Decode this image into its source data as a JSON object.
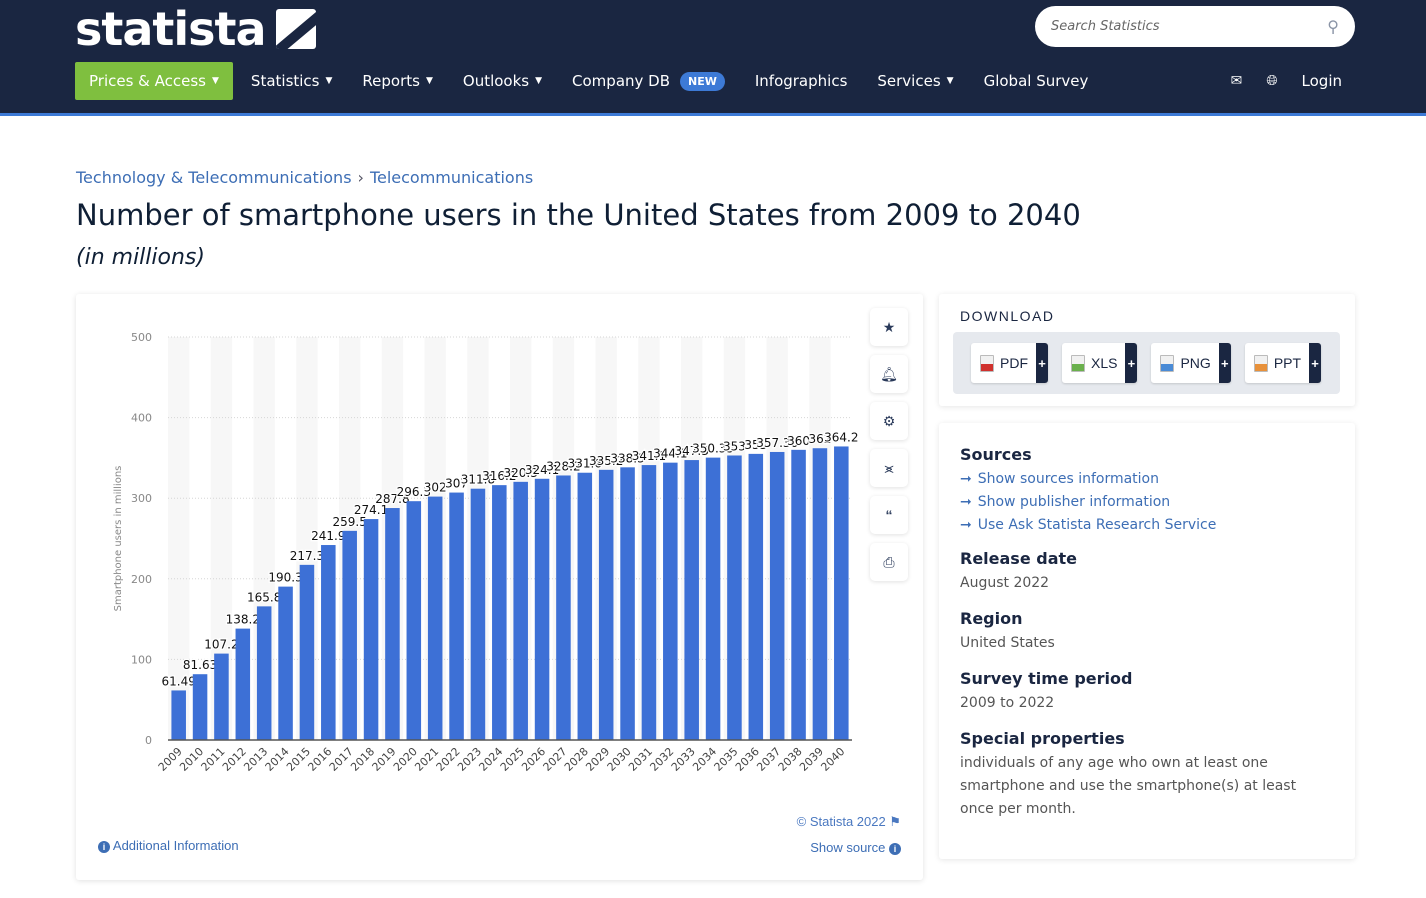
{
  "header": {
    "logo_text": "statista",
    "search_placeholder": "Search Statistics",
    "nav": [
      {
        "label": "Prices & Access",
        "dropdown": true,
        "active": true
      },
      {
        "label": "Statistics",
        "dropdown": true
      },
      {
        "label": "Reports",
        "dropdown": true
      },
      {
        "label": "Outlooks",
        "dropdown": true
      },
      {
        "label": "Company DB",
        "badge": "NEW"
      },
      {
        "label": "Infographics"
      },
      {
        "label": "Services",
        "dropdown": true
      },
      {
        "label": "Global Survey"
      }
    ],
    "login_label": "Login",
    "caret": "▼",
    "colors": {
      "navbar": "#1a2641",
      "active": "#7fbf3f",
      "accent": "#3d7ad6"
    }
  },
  "breadcrumb": [
    "Technology & Telecommunications",
    "Telecommunications"
  ],
  "breadcrumb_sep": "›",
  "page": {
    "title": "Number of smartphone users in the United States from 2009 to 2040",
    "subtitle": "(in millions)"
  },
  "chart_tools": [
    "star-icon",
    "bell-icon",
    "gear-icon",
    "share-icon",
    "quote-icon",
    "print-icon"
  ],
  "chart_footer": {
    "copyright": "© Statista 2022",
    "show_source": "Show source",
    "additional_info": "Additional Information"
  },
  "chart_data": {
    "type": "bar",
    "title": "Number of smartphone users in the United States from 2009 to 2040",
    "xlabel": "",
    "ylabel": "Smartphone users in millions",
    "ylim": [
      0,
      500
    ],
    "yticks": [
      0,
      100,
      200,
      300,
      400,
      500
    ],
    "grid": true,
    "bar_color": "#3d70d6",
    "categories": [
      "2009",
      "2010",
      "2011",
      "2012",
      "2013",
      "2014",
      "2015",
      "2016",
      "2017",
      "2018",
      "2019",
      "2020",
      "2021",
      "2022",
      "2023",
      "2024",
      "2025",
      "2026",
      "2027",
      "2028",
      "2029",
      "2030",
      "2031",
      "2032",
      "2033",
      "2034",
      "2035",
      "2036",
      "2037",
      "2038",
      "2039",
      "2040"
    ],
    "values": [
      61.49,
      81.63,
      107.2,
      138.2,
      165.8,
      190.3,
      217.3,
      241.9,
      259.5,
      274.1,
      287.8,
      296.3,
      302,
      307,
      311.8,
      316.2,
      320.3,
      324.1,
      328.2,
      331.6,
      335.2,
      338.3,
      341.1,
      344.1,
      347.3,
      350.35,
      353,
      355,
      357.36,
      360,
      362,
      364.2
    ],
    "labels": [
      "61.49",
      "81.63",
      "107.2",
      "138.2",
      "165.8",
      "190.3",
      "217.3",
      "241.9",
      "259.5",
      "274.1",
      "287.8",
      "296.3",
      "302",
      "307",
      "311.8",
      "316.2",
      "320.3",
      "324.1",
      "328.2",
      "331.6",
      "335.2",
      "338.3",
      "341.1",
      "344.1",
      "347.3",
      "350.35",
      "353",
      "355",
      "357.36",
      "360",
      "362",
      "364.2"
    ]
  },
  "download": {
    "title": "DOWNLOAD",
    "buttons": [
      {
        "label": "PDF",
        "color": "#d0312d"
      },
      {
        "label": "XLS",
        "color": "#6ab04c"
      },
      {
        "label": "PNG",
        "color": "#4a8bd6"
      },
      {
        "label": "PPT",
        "color": "#e8913a"
      }
    ],
    "plus": "+"
  },
  "info": {
    "sources_heading": "Sources",
    "source_links": [
      "Show sources information",
      "Show publisher information",
      "Use Ask Statista Research Service"
    ],
    "arrow": "➞",
    "release_heading": "Release date",
    "release_value": "August 2022",
    "region_heading": "Region",
    "region_value": "United States",
    "survey_heading": "Survey time period",
    "survey_value": "2009 to 2022",
    "special_heading": "Special properties",
    "special_value": "individuals of any age who own at least one smartphone and use the smartphone(s) at least once per month."
  }
}
